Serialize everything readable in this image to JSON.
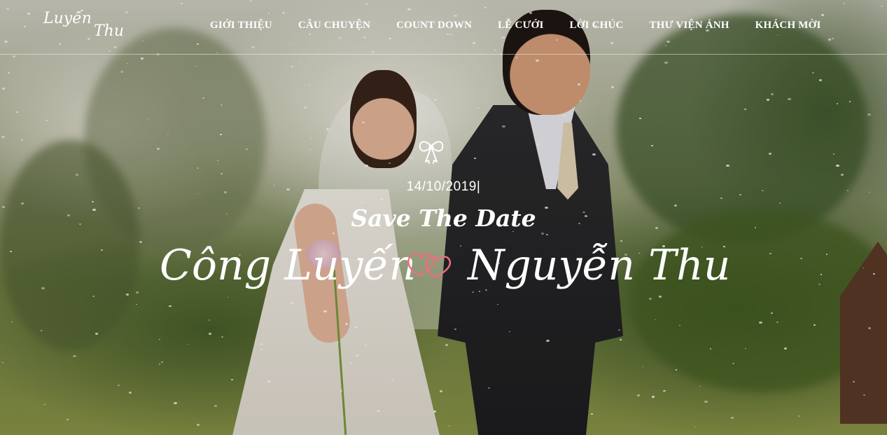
{
  "logo": {
    "line1": "Luyến",
    "line2": "Thu"
  },
  "nav": {
    "items": [
      {
        "label": "GIỚI THIỆU"
      },
      {
        "label": "CÂU CHUYỆN"
      },
      {
        "label": "COUNT DOWN"
      },
      {
        "label": "LỄ CƯỚI"
      },
      {
        "label": "LỜI CHÚC"
      },
      {
        "label": "THƯ VIỆN ẢNH"
      },
      {
        "label": "KHÁCH MỜI"
      }
    ]
  },
  "hero": {
    "date": "14/10/2019|",
    "save_the_date": "Save The Date",
    "groom_name": "Công Luyến",
    "bride_name": "Nguyễn Thu",
    "icons": {
      "top": "bow-icon",
      "between_names": "double-heart-icon"
    },
    "accent_color": "#e8707f"
  }
}
